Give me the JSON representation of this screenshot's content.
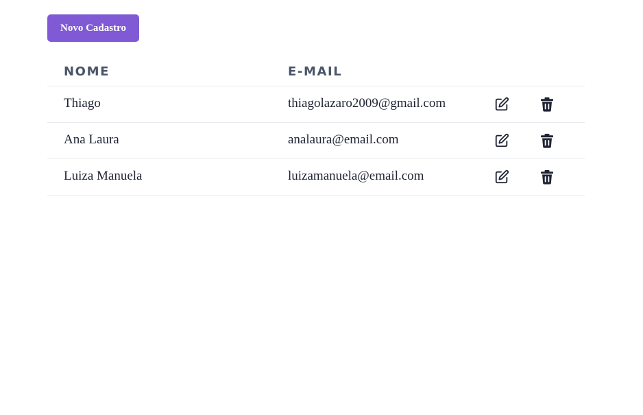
{
  "toolbar": {
    "new_label": "Novo Cadastro"
  },
  "table": {
    "headers": {
      "name": "NOME",
      "email": "E-MAIL"
    },
    "rows": [
      {
        "name": "Thiago",
        "email": "thiagolazaro2009@gmail.com"
      },
      {
        "name": "Ana Laura",
        "email": "analaura@email.com"
      },
      {
        "name": "Luiza Manuela",
        "email": "luizamanuela@email.com"
      }
    ]
  },
  "icons": {
    "edit": "edit-icon",
    "delete": "trash-icon"
  },
  "colors": {
    "accent": "#805ad5",
    "header_text": "#4a5568",
    "body_text": "#1f2333",
    "divider": "#e8ebf0"
  }
}
